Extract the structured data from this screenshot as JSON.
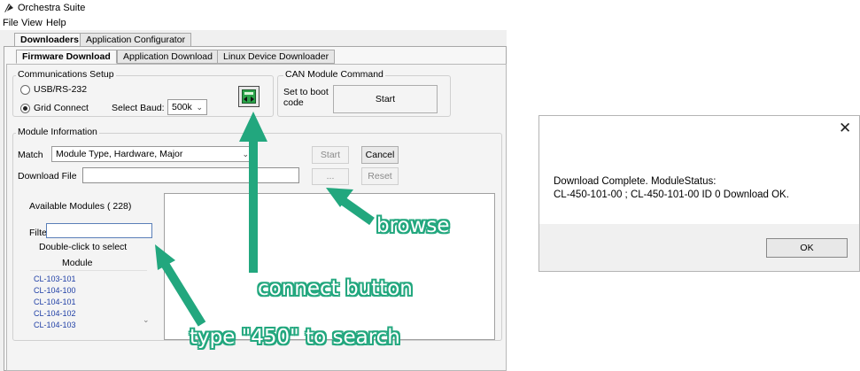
{
  "window": {
    "title": "Orchestra Suite",
    "menu": [
      "File",
      "View",
      "Help"
    ]
  },
  "tabs_top": [
    {
      "label": "Downloaders",
      "active": true
    },
    {
      "label": "Application Configurator",
      "active": false
    }
  ],
  "tabs_sub": [
    {
      "label": "Firmware Download",
      "active": true
    },
    {
      "label": "Application Download",
      "active": false
    },
    {
      "label": "Linux Device Downloader",
      "active": false
    }
  ],
  "comm": {
    "legend": "Communications Setup",
    "radio_usb": "USB/RS-232",
    "radio_grid": "Grid Connect",
    "selected": "Grid Connect",
    "baud_label": "Select Baud:",
    "baud_value": "500k"
  },
  "can": {
    "legend": "CAN Module Command",
    "boot_line1": "Set to boot",
    "boot_line2": "code",
    "start": "Start"
  },
  "module_info": {
    "legend": "Module Information",
    "match_label": "Match",
    "match_value": "Module Type, Hardware, Major",
    "start": "Start",
    "cancel": "Cancel",
    "download_label": "Download File",
    "download_value": "",
    "browse": "...",
    "reset": "Reset"
  },
  "available": {
    "title": "Available Modules ( 228)",
    "filter_label": "Filter",
    "filter_value": "",
    "hint": "Double-click to select",
    "column": "Module",
    "items": [
      "CL-103-101",
      "CL-104-100",
      "CL-104-101",
      "CL-104-102",
      "CL-104-103"
    ]
  },
  "annotations": {
    "browse": "browse",
    "connect": "connect button",
    "search": "type \"450\" to search",
    "color": "#22a77e"
  },
  "dialog": {
    "line1": "Download Complete. ModuleStatus:",
    "line2": "CL-450-101-00 ; CL-450-101-00 ID 0 Download OK.",
    "ok": "OK"
  }
}
